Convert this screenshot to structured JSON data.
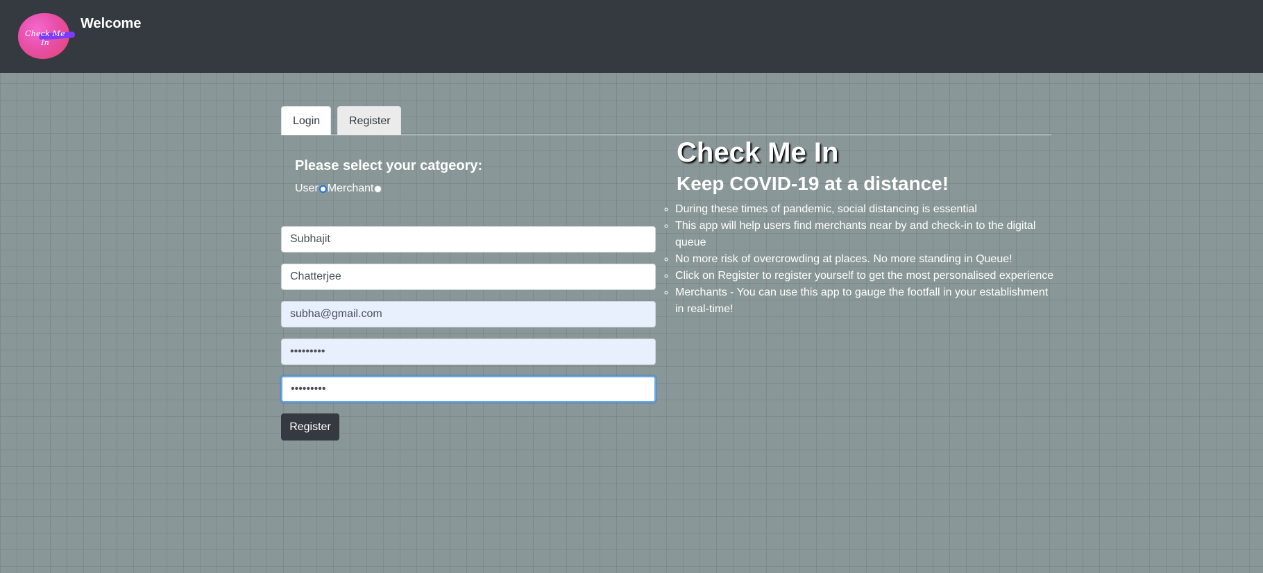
{
  "header": {
    "logo_text": "Check Me In",
    "brand": "Welcome"
  },
  "tabs": [
    {
      "label": "Login"
    },
    {
      "label": "Register"
    }
  ],
  "category": {
    "heading": "Please select your catgeory:",
    "options": [
      {
        "label": "User",
        "selected": true
      },
      {
        "label": "Merchant",
        "selected": false
      }
    ]
  },
  "form": {
    "first_name": "Subhajit",
    "last_name": "Chatterjee",
    "email": "subha@gmail.com",
    "password": "•••••••••",
    "confirm_password": "•••••••••",
    "submit_label": "Register"
  },
  "info": {
    "title": "Check Me In",
    "subtitle": "Keep COVID-19 at a distance!",
    "bullets": [
      "During these times of pandemic, social distancing is essential",
      "This app will help users find merchants near by and check-in to the digital queue",
      "No more risk of overcrowding at places. No more standing in Queue!",
      "Click on Register to register yourself to get the most personalised experience",
      "Merchants - You can use this app to gauge the footfall in your establishment in real-time!"
    ]
  },
  "colors": {
    "navbar": "#343a40",
    "page_background": "#8a9798",
    "button": "#343a40"
  }
}
